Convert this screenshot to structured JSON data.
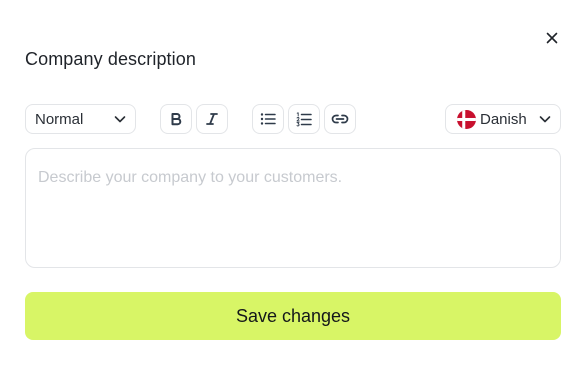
{
  "dialog": {
    "title": "Company description",
    "close_icon": "close-icon"
  },
  "toolbar": {
    "format_select": {
      "value": "Normal",
      "icon": "chevron-down-icon"
    },
    "bold": {
      "label": "B",
      "icon": "bold-icon"
    },
    "italic": {
      "icon": "italic-icon"
    },
    "bullet_list": {
      "icon": "bullet-list-icon"
    },
    "numbered_list": {
      "icon": "numbered-list-icon"
    },
    "link": {
      "icon": "link-icon"
    },
    "language_select": {
      "value": "Danish",
      "flag_icon": "denmark-flag-icon",
      "icon": "chevron-down-icon"
    }
  },
  "editor": {
    "placeholder": "Describe your company to your customers.",
    "value": ""
  },
  "save_button": {
    "label": "Save changes"
  },
  "colors": {
    "accent": "#d8f566",
    "border": "#e3e5e8",
    "placeholder_text": "#c7cacf",
    "text": "#1f2329",
    "flag_red": "#c8102e"
  }
}
